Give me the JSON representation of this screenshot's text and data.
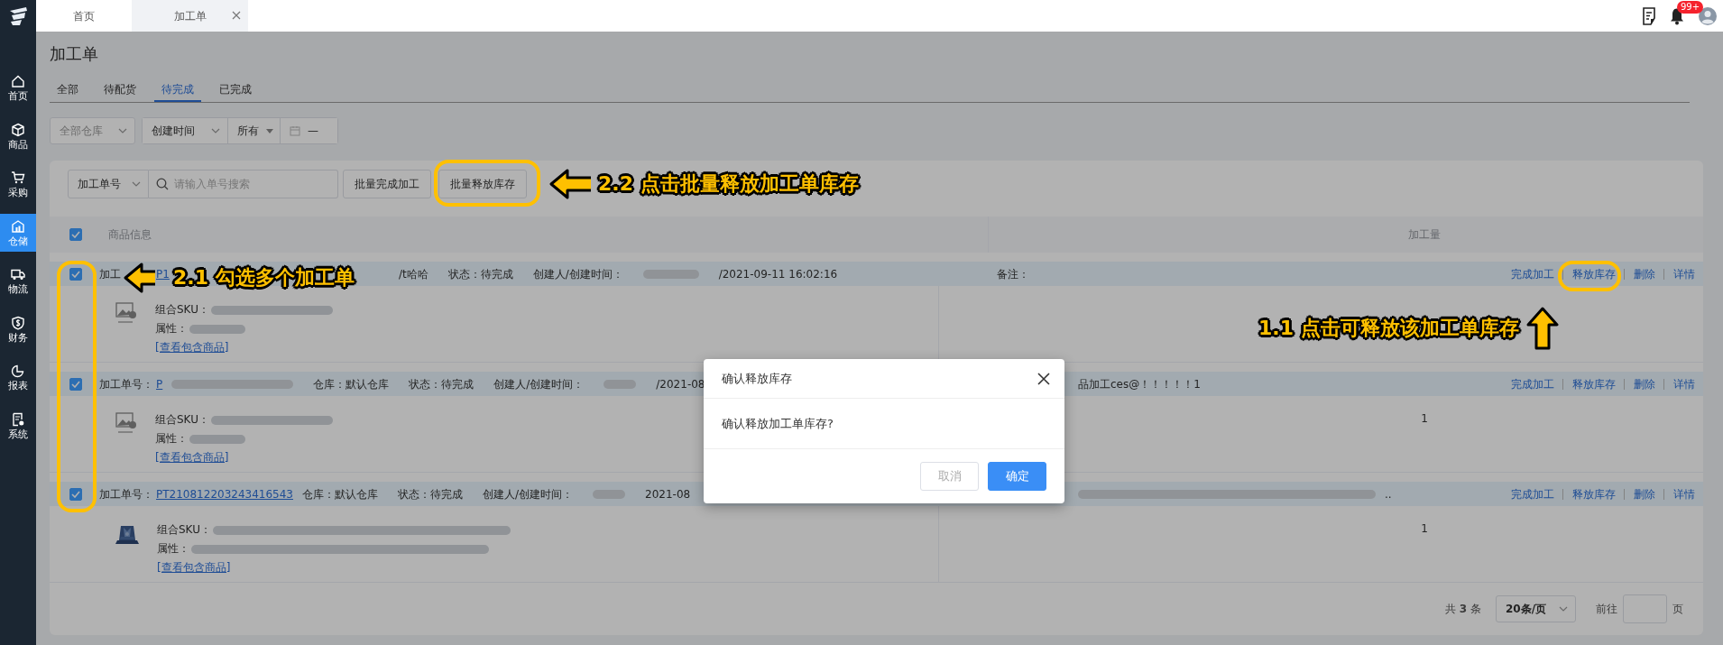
{
  "sidebar": {
    "items": [
      {
        "label": "首页",
        "selected": false
      },
      {
        "label": "商品",
        "selected": false
      },
      {
        "label": "采购",
        "selected": false
      },
      {
        "label": "仓储",
        "selected": true
      },
      {
        "label": "物流",
        "selected": false
      },
      {
        "label": "财务",
        "selected": false
      },
      {
        "label": "报表",
        "selected": false
      },
      {
        "label": "系统",
        "selected": false
      }
    ]
  },
  "top_tabs": [
    {
      "label": "首页",
      "selected": false,
      "closable": false
    },
    {
      "label": "加工单",
      "selected": true,
      "closable": true
    }
  ],
  "notifications": {
    "badge": "99+"
  },
  "page": {
    "title": "加工单",
    "tabs": [
      {
        "label": "全部",
        "selected": false
      },
      {
        "label": "待配货",
        "selected": false
      },
      {
        "label": "待完成",
        "selected": true
      },
      {
        "label": "已完成",
        "selected": false
      }
    ]
  },
  "filters": {
    "warehouse": "全部仓库",
    "time_field": "创建时间",
    "range": "所有",
    "date_separator": "—"
  },
  "toolbar": {
    "search_field": "加工单号",
    "placeholder": "请输入单号搜索",
    "buttons": [
      "批量完成加工",
      "批量释放库存"
    ]
  },
  "table": {
    "all_checked": true,
    "columns": [
      "商品信息",
      "加工量"
    ],
    "rows": [
      {
        "checked": true,
        "header": [
          {
            "kind": "label",
            "text": "加工"
          },
          {
            "kind": "link",
            "text": "P1"
          },
          {
            "kind": "hidden"
          },
          {
            "kind": "text",
            "text": "/t哈哈"
          },
          {
            "kind": "text",
            "text": "状态：待完成"
          },
          {
            "kind": "text",
            "text": "创建人/创建时间："
          },
          {
            "kind": "blur_m"
          },
          {
            "kind": "text",
            "text": "/2021-09-11 16:02:16"
          }
        ],
        "remark": [
          {
            "kind": "text",
            "text": "备注："
          }
        ],
        "actions": [
          "完成加工",
          "释放库存",
          "删除",
          "详情"
        ],
        "kind": "no_image",
        "sku": [
          {
            "kind": "label",
            "text": "组合SKU："
          },
          {
            "kind": "blur_l"
          }
        ],
        "attributes": [
          {
            "kind": "label",
            "text": "属性："
          },
          {
            "kind": "blur_m"
          }
        ],
        "link": "[查看包含商品]"
      },
      {
        "checked": true,
        "header": [
          {
            "kind": "label",
            "text": "加工单号："
          },
          {
            "kind": "link",
            "text": "P"
          },
          {
            "kind": "blur_l"
          },
          {
            "kind": "text",
            "text": "仓库：默认仓库"
          },
          {
            "kind": "text",
            "text": "状态：待完成"
          },
          {
            "kind": "text",
            "text": "创建人/创建时间："
          },
          {
            "kind": "blur_s"
          },
          {
            "kind": "text",
            "text": "/2021-08"
          }
        ],
        "remark": [
          {
            "kind": "hidden"
          },
          {
            "kind": "text",
            "text": "品加工ces@！！！！！1"
          }
        ],
        "actions": [
          "完成加工",
          "释放库存",
          "删除",
          "详情"
        ],
        "kind": "no_image",
        "sku": [
          {
            "kind": "label",
            "text": "组合SKU："
          },
          {
            "kind": "blur_l"
          }
        ],
        "attributes": [
          {
            "kind": "label",
            "text": "属性："
          },
          {
            "kind": "blur_m"
          }
        ],
        "link": "[查看包含商品]",
        "quantity": "1"
      },
      {
        "checked": true,
        "header": [
          {
            "kind": "label",
            "text": "加工单号："
          },
          {
            "kind": "link",
            "text": "PT210812203243416543"
          },
          {
            "kind": "text",
            "text": "仓库：默认仓库"
          },
          {
            "kind": "text",
            "text": "状态：待完成"
          },
          {
            "kind": "text",
            "text": "创建人/创建时间："
          },
          {
            "kind": "blur_s"
          },
          {
            "kind": "text",
            "text": "2021-08"
          }
        ],
        "remark": [
          {
            "kind": "hidden"
          },
          {
            "kind": "blur_xl"
          },
          {
            "kind": "text",
            "text": ".."
          }
        ],
        "actions": [
          "完成加工",
          "释放库存",
          "删除",
          "详情"
        ],
        "kind": "picture",
        "sku": [
          {
            "kind": "label",
            "text": "组合SKU："
          },
          {
            "kind": "blur_xl"
          }
        ],
        "attributes": [
          {
            "kind": "label",
            "text": "属性："
          },
          {
            "kind": "blur_xl"
          }
        ],
        "link": "[查看包含商品]",
        "quantity": "1"
      }
    ]
  },
  "pagination": {
    "total_prefix": "共",
    "total": "3",
    "total_suffix": "条",
    "page_size": "20条/页",
    "goto": "前往",
    "page_suffix": "页"
  },
  "dialog": {
    "title": "确认释放库存",
    "message": "确认释放加工单库存?",
    "buttons": [
      {
        "label": "取消",
        "kind": "secondary"
      },
      {
        "label": "确定",
        "kind": "primary"
      }
    ]
  },
  "annotations": [
    {
      "text": "2.2 点击批量释放加工单库存",
      "kind": "arrow_left"
    },
    {
      "text": "2.1 勾选多个加工单",
      "kind": "arrow_left"
    },
    {
      "text": "1.1 点击可释放该加工单库存",
      "kind": "arrow_up"
    }
  ]
}
